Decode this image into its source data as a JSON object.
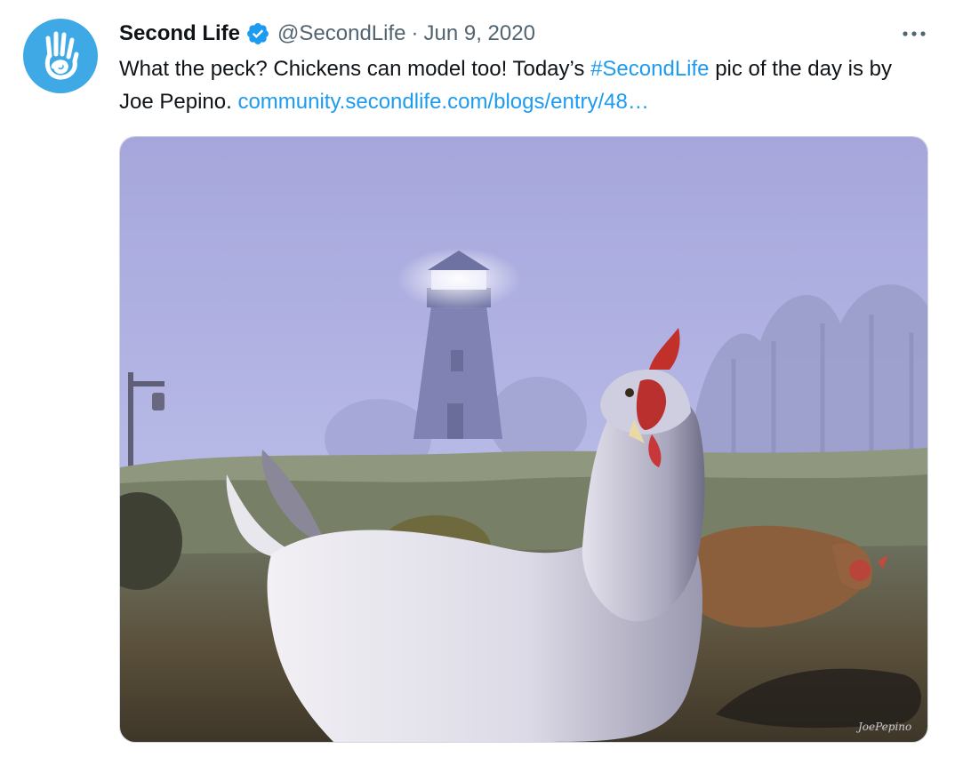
{
  "tweet": {
    "display_name": "Second Life",
    "verified_icon": "verified-badge-icon",
    "handle": "@SecondLife",
    "separator": "·",
    "date": "Jun 9, 2020",
    "more_icon": "more-options-icon",
    "text": {
      "part1": "What the peck? Chickens can model too! Today’s ",
      "hashtag": "#SecondLife",
      "part2": " pic of the day is by Joe Pepino. ",
      "url": "community.secondlife.com/blogs/entry/48…"
    },
    "media": {
      "signature": "JoePepino"
    }
  },
  "colors": {
    "link": "#1d9bf0",
    "avatar_bg": "#3fa9e6",
    "secondary_text": "#536471",
    "verified": "#1d9bf0"
  }
}
